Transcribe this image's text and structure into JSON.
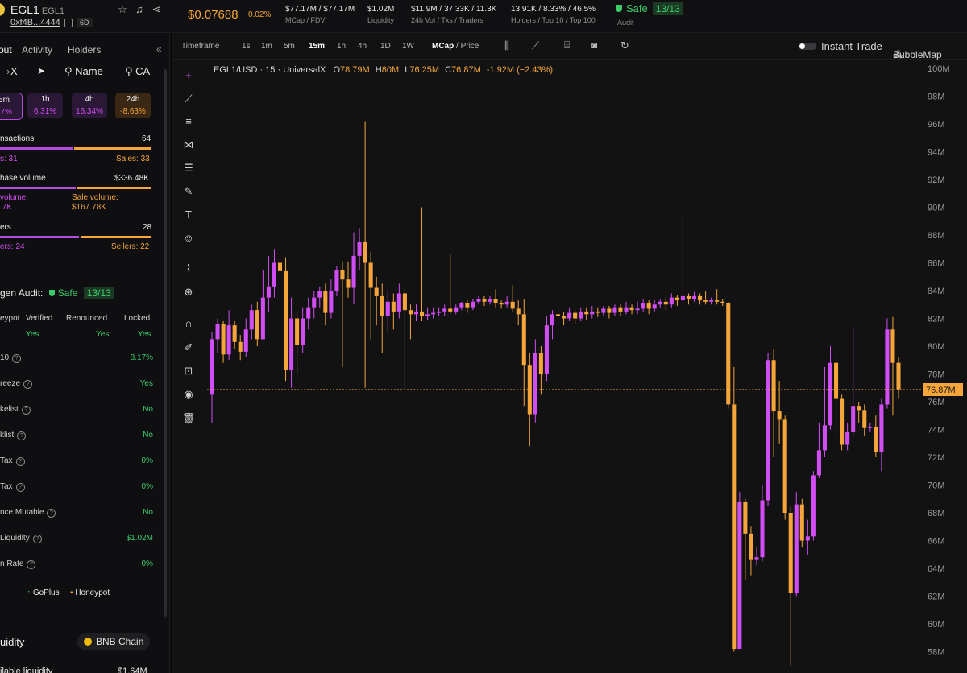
{
  "token": {
    "symbol": "EGL1",
    "name": "EGL1",
    "address": "0xf4B...4444",
    "age": "6D",
    "price": "$0.07688",
    "price_change": "0.02%"
  },
  "stats": [
    {
      "value": "$77.17M / $77.17M",
      "label": "MCap / FDV"
    },
    {
      "value": "$1.02M",
      "label": "Liquidity"
    },
    {
      "value": "$11.9M / 37.33K / 11.3K",
      "label": "24h Vol / Txs / Traders"
    },
    {
      "value": "13.91K / 8.33% / 46.5%",
      "label": "Holders / Top 10 / Top 100"
    }
  ],
  "audit_header": {
    "safe": "Safe",
    "score": "13/13",
    "label": "Audit"
  },
  "left_tabs": [
    "out",
    "Activity",
    "Holders"
  ],
  "social": {
    "x": "X",
    "name": "Name",
    "ca": "CA"
  },
  "timeframes": [
    {
      "label": "5m",
      "value": "67%",
      "color": "#d14df5"
    },
    {
      "label": "1h",
      "value": "6.31%",
      "color": "#d14df5"
    },
    {
      "label": "4h",
      "value": "16.34%",
      "color": "#d14df5"
    },
    {
      "label": "24h",
      "value": "-8.63%",
      "color": "#f5a53a"
    }
  ],
  "txns": {
    "label": "nsactions",
    "total": "64",
    "buys": "s: 31",
    "sales": "Sales: 33",
    "buy_fraction": 0.48
  },
  "volume": {
    "label": "hase volume",
    "total": "$336.48K",
    "buy_label": "volume:",
    "buy_value": ".7K",
    "sell_label": "Sale volume:",
    "sell_value": "$167.78K",
    "buy_fraction": 0.5
  },
  "makers": {
    "label": "ers",
    "total": "28",
    "buyers": "ers: 24",
    "sellers": "Sellers: 22",
    "buy_fraction": 0.52
  },
  "audit": {
    "title": "gen Audit:",
    "safe": "Safe",
    "score": "13/13",
    "cols": [
      "eypot",
      "Verified",
      "Renounced",
      "Locked"
    ],
    "col_values": [
      "Yes",
      "Yes",
      "Yes"
    ],
    "rows": [
      {
        "k": "10",
        "v": "8.17%"
      },
      {
        "k": "reeze",
        "v": "Yes"
      },
      {
        "k": "kelist",
        "v": "No"
      },
      {
        "k": "klist",
        "v": "No"
      },
      {
        "k": "Tax",
        "v": "0%"
      },
      {
        "k": "Tax",
        "v": "0%"
      },
      {
        "k": "nce Mutable",
        "v": "No"
      },
      {
        "k": "Liquidity",
        "v": "$1.02M"
      },
      {
        "k": "n Rate",
        "v": "0%"
      }
    ],
    "providers": [
      "GoPlus",
      "Honeypot"
    ]
  },
  "liquidity": {
    "title": "uidity",
    "chain": "BNB Chain",
    "sub_label": "ilable liquidity",
    "sub_value": "$1.64M"
  },
  "toolbar": {
    "timeframe_label": "Timeframe",
    "intervals": [
      "1s",
      "1m",
      "5m",
      "15m",
      "1h",
      "4h",
      "1D",
      "1W"
    ],
    "active_interval": "15m",
    "mcap": "MCap",
    "price": "/ Price",
    "instant_trade": "Instant Trade",
    "bubblemap": "BubbleMap"
  },
  "ohlc": {
    "pair": "EGL1/USD · 15 · UniversalX",
    "o": "78.79M",
    "h": "80M",
    "l": "76.25M",
    "c": "76.87M",
    "change": "-1.92M (−2.43%)"
  },
  "chart_data": {
    "type": "candlestick",
    "y_unit": "M",
    "ylim": [
      56,
      100
    ],
    "y_ticks": [
      58,
      60,
      62,
      64,
      66,
      68,
      70,
      72,
      74,
      76,
      78,
      80,
      82,
      84,
      86,
      88,
      90,
      92,
      94,
      96,
      98,
      100
    ],
    "y_tick_labels": [
      "58M",
      "60M",
      "62M",
      "64M",
      "66M",
      "68M",
      "70M",
      "72M",
      "74M",
      "76M",
      "78M",
      "80M",
      "82M",
      "84M",
      "86M",
      "88M",
      "90M",
      "92M",
      "94M",
      "96M",
      "98M",
      "100M"
    ],
    "last_price": 76.87,
    "last_price_label": "76.87M",
    "up_color": "#d14df5",
    "down_color": "#f5a53a",
    "candles": [
      [
        76.5,
        80.5,
        81.0,
        74.5
      ],
      [
        80.5,
        81.6,
        82.0,
        79.5
      ],
      [
        81.6,
        79.4,
        81.8,
        78.8
      ],
      [
        79.4,
        81.5,
        82.6,
        79.0
      ],
      [
        81.5,
        80.3,
        81.8,
        79.8
      ],
      [
        80.3,
        79.6,
        80.8,
        79.0
      ],
      [
        79.6,
        81.2,
        82.0,
        79.2
      ],
      [
        81.2,
        82.6,
        83.0,
        80.5
      ],
      [
        82.6,
        80.5,
        83.2,
        80.0
      ],
      [
        80.5,
        83.5,
        85.5,
        80.5
      ],
      [
        83.5,
        84.3,
        86.5,
        82.5
      ],
      [
        84.3,
        86.0,
        87.0,
        83.5
      ],
      [
        86.0,
        85.4,
        94.0,
        77.5
      ],
      [
        85.4,
        78.3,
        86.4,
        77.5
      ],
      [
        78.3,
        82.0,
        83.5,
        77.0
      ],
      [
        82.0,
        80.1,
        82.5,
        78.0
      ],
      [
        80.1,
        82.0,
        82.8,
        79.5
      ],
      [
        82.0,
        82.8,
        83.5,
        81.2
      ],
      [
        82.8,
        83.5,
        84.0,
        82.0
      ],
      [
        83.5,
        84.0,
        84.3,
        82.8
      ],
      [
        84.0,
        82.4,
        84.5,
        81.5
      ],
      [
        82.4,
        84.0,
        84.8,
        82.0
      ],
      [
        84.0,
        85.5,
        85.8,
        83.6
      ],
      [
        85.5,
        84.8,
        86.1,
        78.5
      ],
      [
        84.8,
        84.2,
        86.1,
        83.5
      ],
      [
        84.2,
        86.5,
        88.2,
        83.0
      ],
      [
        86.5,
        87.5,
        88.5,
        85.5
      ],
      [
        87.5,
        86.0,
        96.2,
        77.0
      ],
      [
        86.0,
        84.2,
        86.8,
        80.5
      ],
      [
        84.2,
        83.6,
        85.0,
        81.5
      ],
      [
        83.6,
        82.2,
        84.5,
        79.5
      ],
      [
        82.2,
        83.2,
        84.0,
        81.0
      ],
      [
        83.2,
        82.5,
        83.8,
        81.2
      ],
      [
        82.5,
        83.8,
        84.5,
        82.0
      ],
      [
        83.8,
        82.6,
        84.1,
        76.8
      ],
      [
        82.6,
        82.3,
        83.0,
        80.5
      ],
      [
        82.3,
        82.5,
        83.0,
        81.8
      ],
      [
        82.5,
        82.2,
        90.0,
        81.8
      ],
      [
        82.2,
        82.3,
        82.8,
        81.9
      ],
      [
        82.3,
        82.4,
        82.8,
        82.0
      ],
      [
        82.4,
        82.5,
        82.8,
        82.2
      ],
      [
        82.5,
        82.7,
        83.0,
        82.2
      ],
      [
        82.7,
        82.5,
        86.6,
        82.3
      ],
      [
        82.5,
        82.8,
        83.0,
        82.3
      ],
      [
        82.8,
        83.1,
        83.2,
        82.6
      ],
      [
        83.1,
        82.8,
        83.3,
        82.4
      ],
      [
        82.8,
        83.2,
        83.4,
        82.6
      ],
      [
        83.2,
        83.4,
        83.6,
        83.0
      ],
      [
        83.4,
        83.2,
        83.6,
        82.9
      ],
      [
        83.2,
        83.4,
        83.6,
        83.0
      ],
      [
        83.4,
        83.1,
        84.1,
        82.8
      ],
      [
        83.1,
        83.0,
        83.3,
        82.7
      ],
      [
        83.0,
        83.2,
        83.6,
        82.8
      ],
      [
        83.2,
        82.7,
        84.4,
        82.5
      ],
      [
        82.7,
        82.3,
        83.3,
        81.5
      ],
      [
        82.3,
        78.6,
        83.4,
        75.7
      ],
      [
        78.6,
        75.1,
        79.5,
        72.8
      ],
      [
        75.1,
        79.5,
        80.5,
        74.5
      ],
      [
        79.5,
        78.0,
        80.0,
        76.5
      ],
      [
        78.0,
        81.5,
        82.2,
        77.5
      ],
      [
        81.5,
        82.3,
        82.6,
        80.5
      ],
      [
        82.3,
        82.2,
        82.8,
        81.8
      ],
      [
        82.2,
        82.0,
        82.5,
        81.5
      ],
      [
        82.0,
        82.4,
        82.8,
        81.8
      ],
      [
        82.4,
        82.0,
        82.6,
        81.6
      ],
      [
        82.0,
        82.5,
        82.8,
        81.8
      ],
      [
        82.5,
        82.3,
        82.8,
        81.9
      ],
      [
        82.3,
        82.5,
        82.9,
        82.0
      ],
      [
        82.5,
        82.4,
        82.8,
        82.1
      ],
      [
        82.4,
        82.7,
        82.9,
        82.2
      ],
      [
        82.7,
        82.4,
        82.9,
        82.0
      ],
      [
        82.4,
        82.8,
        83.0,
        82.2
      ],
      [
        82.8,
        82.5,
        83.0,
        82.2
      ],
      [
        82.5,
        82.8,
        83.2,
        82.3
      ],
      [
        82.8,
        82.6,
        83.0,
        82.3
      ],
      [
        82.6,
        82.7,
        83.2,
        82.3
      ],
      [
        82.7,
        83.1,
        83.4,
        82.5
      ],
      [
        83.1,
        82.7,
        83.3,
        82.3
      ],
      [
        82.7,
        83.0,
        83.3,
        82.5
      ],
      [
        83.0,
        83.2,
        83.4,
        82.8
      ],
      [
        83.2,
        83.0,
        83.5,
        82.6
      ],
      [
        83.0,
        83.5,
        83.8,
        82.8
      ],
      [
        83.5,
        83.3,
        83.7,
        82.9
      ],
      [
        83.3,
        83.6,
        89.5,
        83.0
      ],
      [
        83.6,
        83.4,
        83.8,
        83.0
      ],
      [
        83.4,
        83.6,
        83.9,
        83.2
      ],
      [
        83.6,
        83.3,
        83.8,
        83.0
      ],
      [
        83.3,
        83.2,
        84.0,
        83.0
      ],
      [
        83.2,
        83.3,
        83.5,
        83.0
      ],
      [
        83.3,
        83.2,
        84.1,
        83.0
      ],
      [
        83.2,
        83.1,
        83.4,
        82.9
      ],
      [
        83.1,
        75.8,
        83.2,
        75.5
      ],
      [
        75.8,
        58.2,
        78.5,
        58.0
      ],
      [
        58.2,
        68.8,
        69.5,
        58.5
      ],
      [
        68.8,
        66.5,
        69.0,
        63.2
      ],
      [
        66.5,
        64.6,
        67.0,
        63.5
      ],
      [
        64.6,
        64.8,
        65.5,
        64.2
      ],
      [
        64.8,
        68.9,
        70.0,
        64.5
      ],
      [
        68.9,
        79.0,
        79.5,
        68.5
      ],
      [
        79.0,
        75.3,
        79.8,
        72.0
      ],
      [
        75.3,
        74.7,
        77.5,
        73.0
      ],
      [
        74.7,
        68.0,
        75.0,
        67.5
      ],
      [
        68.0,
        62.2,
        68.5,
        57.0
      ],
      [
        62.2,
        68.6,
        69.5,
        62.0
      ],
      [
        68.6,
        66.0,
        69.0,
        65.5
      ],
      [
        66.0,
        66.3,
        67.5,
        65.0
      ],
      [
        66.3,
        70.7,
        71.0,
        66.0
      ],
      [
        70.7,
        72.5,
        74.5,
        70.5
      ],
      [
        72.5,
        74.3,
        78.5,
        72.0
      ],
      [
        74.3,
        78.8,
        80.0,
        74.0
      ],
      [
        78.8,
        76.2,
        79.5,
        73.5
      ],
      [
        76.2,
        72.9,
        76.5,
        72.5
      ],
      [
        72.9,
        73.8,
        74.5,
        72.5
      ],
      [
        73.8,
        75.7,
        81.3,
        73.5
      ],
      [
        75.7,
        75.4,
        76.0,
        74.5
      ],
      [
        75.4,
        74.1,
        75.8,
        73.5
      ],
      [
        74.1,
        74.2,
        74.5,
        73.8
      ],
      [
        74.2,
        72.4,
        75.0,
        72.0
      ],
      [
        72.4,
        75.8,
        76.2,
        71.0
      ],
      [
        75.8,
        81.2,
        82.0,
        75.5
      ],
      [
        81.2,
        78.8,
        82.1,
        75.0
      ],
      [
        78.8,
        76.9,
        79.2,
        76.2
      ]
    ]
  }
}
